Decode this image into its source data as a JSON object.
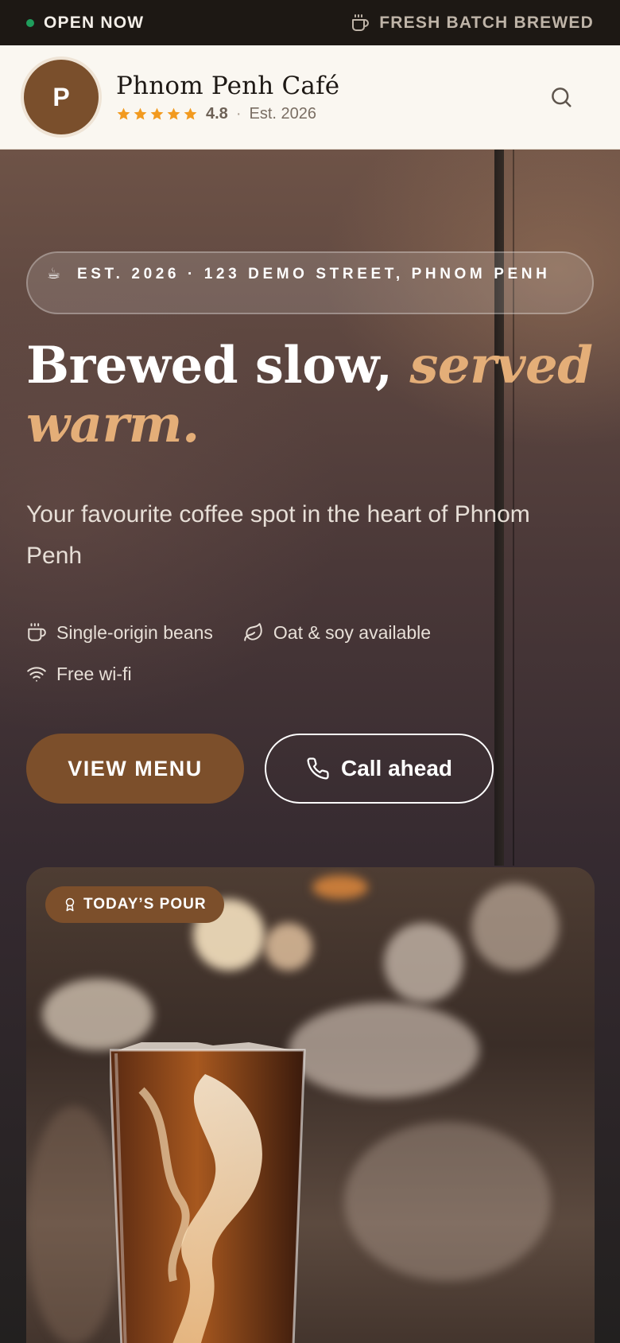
{
  "status_bar": {
    "open_label": "OPEN NOW",
    "fresh_label": "FRESH BATCH BREWED",
    "open_color": "#1f9d5c"
  },
  "header": {
    "avatar_initial": "P",
    "cafe_name": "Phnom Penh Café",
    "rating_value": "4.8",
    "rating_stars": 5,
    "separator": "·",
    "established": "Est. 2026",
    "search_icon": "search-icon"
  },
  "hero": {
    "address_icon": "☕",
    "address": "EST. 2026 · 123 DEMO STREET, PHNOM PENH",
    "headline_plain": "Brewed slow,",
    "headline_italic": "served warm.",
    "tagline": "Your favourite coffee spot in the heart of Phnom Penh",
    "features": [
      {
        "icon": "coffee-cup-icon",
        "label": "Single-origin beans"
      },
      {
        "icon": "leaf-icon",
        "label": "Oat & soy available"
      },
      {
        "icon": "wifi-icon",
        "label": "Free wi-fi"
      }
    ],
    "primary_button": "VIEW MENU",
    "secondary_button": "Call ahead",
    "accent_color": "#e4ae78",
    "brand_color": "#7c4f2b"
  },
  "feature_card": {
    "badge_label": "TODAY’S POUR",
    "badge_icon": "award-icon"
  }
}
